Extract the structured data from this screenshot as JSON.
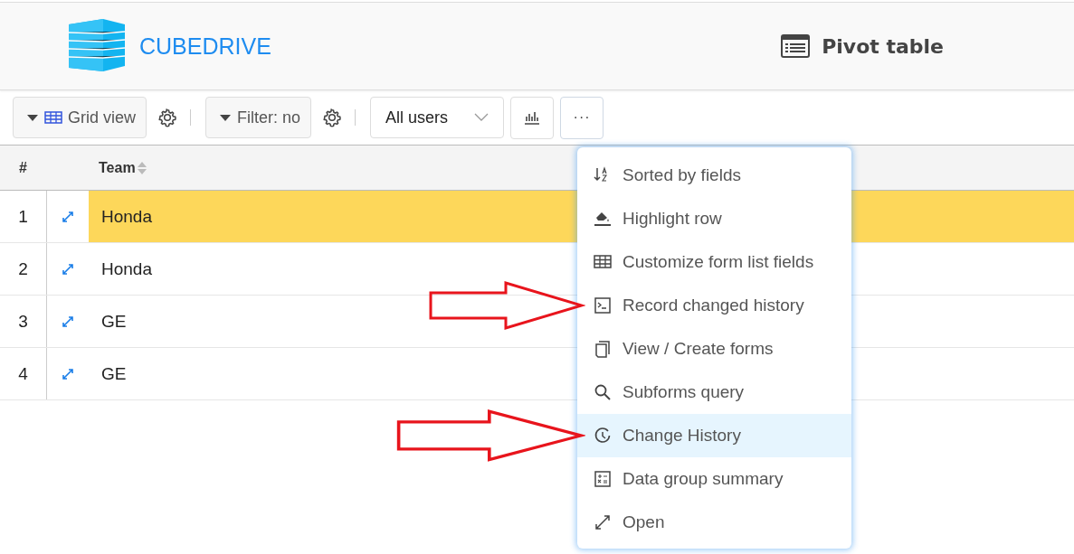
{
  "header": {
    "brand": "CUBEDRIVE",
    "title": "Pivot table"
  },
  "toolbar": {
    "view_button": "Grid view",
    "filter_button": "Filter: no",
    "users_select": "All users",
    "more_button": {
      "label": "···",
      "expanded": true
    }
  },
  "table": {
    "columns": [
      "#",
      "Team"
    ],
    "rows": [
      {
        "number": "1",
        "team": "Honda",
        "highlighted": true
      },
      {
        "number": "2",
        "team": "Honda",
        "highlighted": false
      },
      {
        "number": "3",
        "team": "GE",
        "highlighted": false
      },
      {
        "number": "4",
        "team": "GE",
        "highlighted": false
      }
    ]
  },
  "menu": {
    "items": [
      {
        "label": "Sorted by fields",
        "selected": false
      },
      {
        "label": "Highlight row",
        "selected": false
      },
      {
        "label": "Customize form list fields",
        "selected": false
      },
      {
        "label": "Record changed history",
        "selected": false
      },
      {
        "label": "View / Create forms",
        "selected": false
      },
      {
        "label": "Subforms query",
        "selected": false
      },
      {
        "label": "Change History",
        "selected": true
      },
      {
        "label": "Data group summary",
        "selected": false
      },
      {
        "label": "Open",
        "selected": false
      }
    ]
  }
}
